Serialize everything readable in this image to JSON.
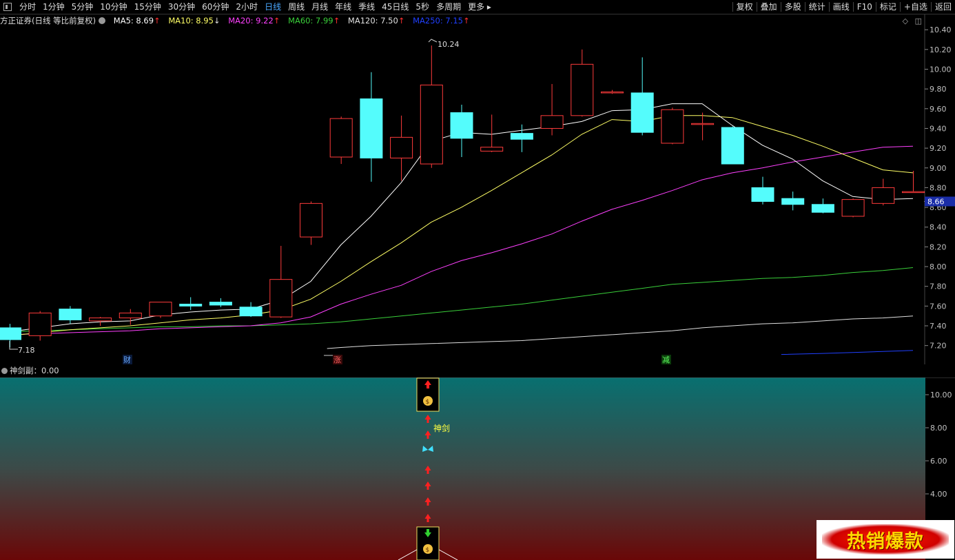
{
  "toolbar": {
    "periods": [
      "分时",
      "1分钟",
      "5分钟",
      "10分钟",
      "15分钟",
      "30分钟",
      "60分钟",
      "2小时",
      "日线",
      "周线",
      "月线",
      "年线",
      "季线",
      "45日线",
      "5秒",
      "多周期",
      "更多"
    ],
    "active_period": "日线",
    "right_buttons": [
      "复权",
      "叠加",
      "多股",
      "统计",
      "画线",
      "F10",
      "标记",
      "+自选",
      "返回"
    ]
  },
  "legend": {
    "stock": "方正证券(日线 等比前复权)",
    "ma5": "MA5: 8.69",
    "ma10": "MA10: 8.95",
    "ma20": "MA20: 9.22",
    "ma60": "MA60: 7.99",
    "ma120": "MA120: 7.50",
    "ma250": "MA250: 7.15",
    "arrow_up": "↑",
    "arrow_down": "↓"
  },
  "colors": {
    "up": "#ff3b3b",
    "down": "#54fcfc",
    "ma5": "#ffffff",
    "ma10": "#ffff66",
    "ma20": "#ff40ff",
    "ma60": "#3ad03a",
    "ma120": "#e0e0e0",
    "ma250": "#2040ff",
    "last_price_bg": "#1a2da8",
    "axis_text": "#c0c0c0"
  },
  "price_axis": {
    "ticks": [
      "10.40",
      "10.20",
      "10.00",
      "9.80",
      "9.60",
      "9.40",
      "9.20",
      "9.00",
      "8.80",
      "8.60",
      "8.40",
      "8.20",
      "8.00",
      "7.80",
      "7.60",
      "7.40",
      "7.20"
    ],
    "last_price": "8.66"
  },
  "annotations": {
    "high_label": "10.24",
    "low_label": "7.18",
    "event_cai": "财",
    "event_zhang": "涨",
    "event_jian": "减"
  },
  "chart_data": {
    "type": "candlestick",
    "ylim": [
      7.1,
      10.45
    ],
    "candles": [
      {
        "o": 7.38,
        "h": 7.42,
        "l": 7.18,
        "c": 7.26
      },
      {
        "o": 7.3,
        "h": 7.55,
        "l": 7.25,
        "c": 7.53
      },
      {
        "o": 7.57,
        "h": 7.6,
        "l": 7.42,
        "c": 7.46
      },
      {
        "o": 7.45,
        "h": 7.49,
        "l": 7.4,
        "c": 7.48
      },
      {
        "o": 7.48,
        "h": 7.57,
        "l": 7.41,
        "c": 7.53
      },
      {
        "o": 7.5,
        "h": 7.64,
        "l": 7.48,
        "c": 7.64
      },
      {
        "o": 7.62,
        "h": 7.69,
        "l": 7.56,
        "c": 7.6
      },
      {
        "o": 7.64,
        "h": 7.68,
        "l": 7.59,
        "c": 7.61
      },
      {
        "o": 7.59,
        "h": 7.64,
        "l": 7.49,
        "c": 7.5
      },
      {
        "o": 7.49,
        "h": 8.21,
        "l": 7.48,
        "c": 7.87
      },
      {
        "o": 8.3,
        "h": 8.66,
        "l": 8.22,
        "c": 8.64
      },
      {
        "o": 9.11,
        "h": 9.52,
        "l": 9.04,
        "c": 9.5
      },
      {
        "o": 9.7,
        "h": 9.97,
        "l": 8.86,
        "c": 9.1
      },
      {
        "o": 9.1,
        "h": 9.53,
        "l": 8.87,
        "c": 9.31
      },
      {
        "o": 9.04,
        "h": 10.24,
        "l": 9.0,
        "c": 9.84
      },
      {
        "o": 9.56,
        "h": 9.64,
        "l": 9.11,
        "c": 9.3
      },
      {
        "o": 9.17,
        "h": 9.54,
        "l": 9.16,
        "c": 9.21
      },
      {
        "o": 9.35,
        "h": 9.44,
        "l": 9.16,
        "c": 9.29
      },
      {
        "o": 9.4,
        "h": 9.85,
        "l": 9.33,
        "c": 9.53
      },
      {
        "o": 9.53,
        "h": 10.2,
        "l": 9.52,
        "c": 10.05
      },
      {
        "o": 9.77,
        "h": 9.79,
        "l": 9.75,
        "c": 9.77
      },
      {
        "o": 9.76,
        "h": 10.12,
        "l": 9.33,
        "c": 9.36
      },
      {
        "o": 9.25,
        "h": 9.61,
        "l": 9.24,
        "c": 9.59
      },
      {
        "o": 9.45,
        "h": 9.56,
        "l": 9.28,
        "c": 9.45
      },
      {
        "o": 9.41,
        "h": 9.42,
        "l": 9.04,
        "c": 9.04
      },
      {
        "o": 8.8,
        "h": 8.91,
        "l": 8.63,
        "c": 8.66
      },
      {
        "o": 8.69,
        "h": 8.76,
        "l": 8.57,
        "c": 8.63
      },
      {
        "o": 8.63,
        "h": 8.69,
        "l": 8.54,
        "c": 8.55
      },
      {
        "o": 8.51,
        "h": 8.69,
        "l": 8.5,
        "c": 8.68
      },
      {
        "o": 8.64,
        "h": 8.89,
        "l": 8.62,
        "c": 8.8
      },
      {
        "o": 8.76,
        "h": 8.97,
        "l": 8.76,
        "c": 8.76
      }
    ],
    "ma5": [
      7.34,
      7.38,
      7.42,
      7.44,
      7.45,
      7.51,
      7.54,
      7.56,
      7.57,
      7.66,
      7.85,
      8.22,
      8.51,
      8.85,
      9.27,
      9.36,
      9.34,
      9.38,
      9.42,
      9.47,
      9.58,
      9.59,
      9.65,
      9.65,
      9.43,
      9.23,
      9.09,
      8.87,
      8.71,
      8.68,
      8.69
    ],
    "ma10": [
      7.3,
      7.33,
      7.36,
      7.38,
      7.4,
      7.43,
      7.46,
      7.48,
      7.51,
      7.56,
      7.67,
      7.85,
      8.05,
      8.24,
      8.45,
      8.6,
      8.77,
      8.95,
      9.13,
      9.34,
      9.49,
      9.47,
      9.53,
      9.53,
      9.51,
      9.42,
      9.33,
      9.22,
      9.1,
      8.98,
      8.95
    ],
    "ma20": [
      7.31,
      7.32,
      7.33,
      7.34,
      7.35,
      7.37,
      7.38,
      7.39,
      7.4,
      7.43,
      7.49,
      7.62,
      7.72,
      7.81,
      7.95,
      8.06,
      8.14,
      8.23,
      8.33,
      8.46,
      8.58,
      8.67,
      8.77,
      8.88,
      8.95,
      9.0,
      9.06,
      9.11,
      9.16,
      9.21,
      9.22
    ],
    "ma60": [
      7.34,
      7.35,
      7.36,
      7.37,
      7.38,
      7.39,
      7.39,
      7.4,
      7.4,
      7.41,
      7.42,
      7.44,
      7.47,
      7.5,
      7.53,
      7.56,
      7.59,
      7.62,
      7.66,
      7.7,
      7.74,
      7.78,
      7.82,
      7.84,
      7.86,
      7.88,
      7.89,
      7.91,
      7.94,
      7.96,
      7.99
    ],
    "ma120": [
      null,
      null,
      null,
      null,
      null,
      null,
      null,
      null,
      null,
      null,
      null,
      7.18,
      7.2,
      7.21,
      7.22,
      7.23,
      7.24,
      7.25,
      7.27,
      7.29,
      7.31,
      7.33,
      7.35,
      7.38,
      7.4,
      7.42,
      7.43,
      7.45,
      7.47,
      7.48,
      7.5
    ],
    "ma250": [
      null,
      null,
      null,
      null,
      null,
      null,
      null,
      null,
      null,
      null,
      null,
      null,
      null,
      null,
      null,
      null,
      null,
      null,
      null,
      null,
      null,
      null,
      null,
      null,
      null,
      null,
      null,
      7.12,
      7.13,
      7.14,
      7.15
    ]
  },
  "sub_panel": {
    "title": "神剑副：0.00",
    "signal_label": "神剑",
    "ticks": [
      "10.00",
      "8.00",
      "6.00",
      "4.00"
    ]
  },
  "badge": {
    "text": "热销爆款"
  }
}
